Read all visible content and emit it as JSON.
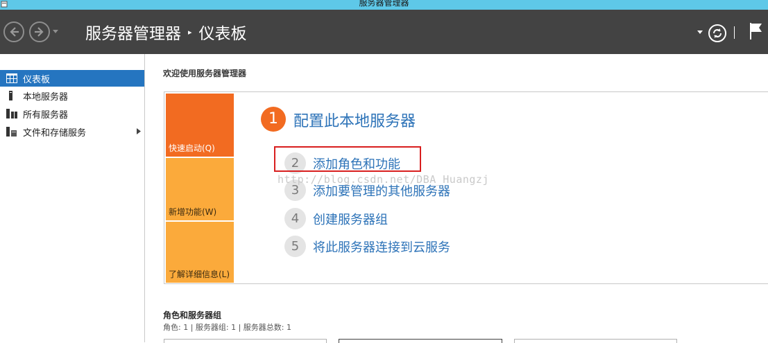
{
  "window": {
    "title": "服务器管理器"
  },
  "header": {
    "breadcrumb_root": "服务器管理器",
    "breadcrumb_separator": "▸",
    "breadcrumb_current": "仪表板",
    "divider": "|"
  },
  "sidebar": {
    "items": [
      {
        "label": "仪表板",
        "icon": "dashboard-icon",
        "active": true
      },
      {
        "label": "本地服务器",
        "icon": "server-icon",
        "active": false
      },
      {
        "label": "所有服务器",
        "icon": "servers-icon",
        "active": false
      },
      {
        "label": "文件和存储服务",
        "icon": "storage-icon",
        "active": false,
        "expandable": true
      }
    ]
  },
  "main": {
    "welcome_title": "欢迎使用服务器管理器",
    "tiles": {
      "quick_start": "快速启动(Q)",
      "whats_new": "新增功能(W)",
      "learn_more": "了解详细信息(L)"
    },
    "step1": {
      "number": "1",
      "label": "配置此本地服务器"
    },
    "steps": [
      {
        "number": "2",
        "label": "添加角色和功能"
      },
      {
        "number": "3",
        "label": "添加要管理的其他服务器"
      },
      {
        "number": "4",
        "label": "创建服务器组"
      },
      {
        "number": "5",
        "label": "将此服务器连接到云服务"
      }
    ],
    "watermark": "http://blog.csdn.net/DBA_Huangzj",
    "roles_section": {
      "title": "角色和服务器组",
      "subtitle": "角色: 1 | 服务器组: 1 | 服务器总数: 1"
    }
  },
  "colors": {
    "header_bg": "#434343",
    "titlebar_bg": "#5ec8e8",
    "accent_orange": "#f26b21",
    "tile_yellow": "#fbaa3b",
    "link_blue": "#2d73b8",
    "active_blue": "#2575c0",
    "highlight_red": "#d81e1e"
  }
}
